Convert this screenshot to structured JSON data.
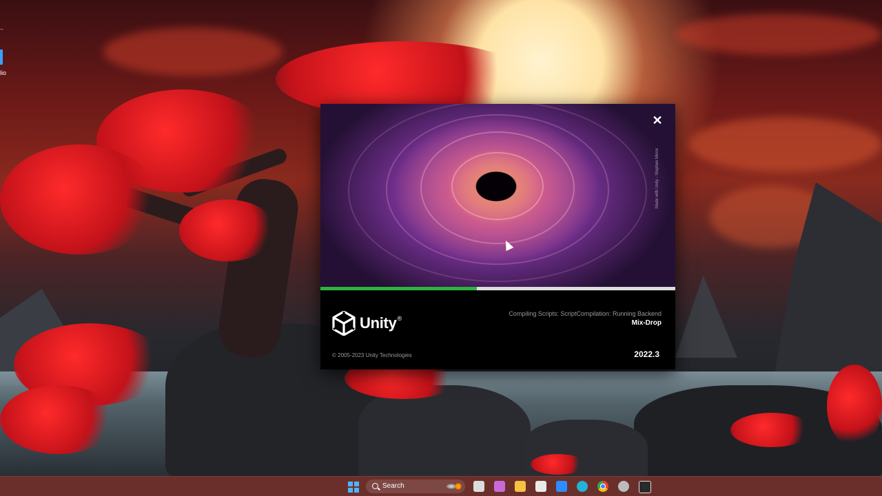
{
  "desktop": {
    "icon_labels": [
      "..",
      "lio"
    ]
  },
  "splash": {
    "watermark": "Made with Unity - Stephen Mirror",
    "progress_percent": 44,
    "logo_text": "Unity",
    "logo_reg": "®",
    "status_text": "Compiling Scripts: ScriptCompilation: Running Backend",
    "project_name": "Mix-Drop",
    "copyright": "© 2005-2023 Unity Technologies",
    "version": "2022.3",
    "close_symbol": "✕"
  },
  "taskbar": {
    "search_label": "Search",
    "apps": [
      {
        "name": "task-view-icon",
        "color": "#dcdcdc"
      },
      {
        "name": "copilot-icon",
        "color": "#c86ad8"
      },
      {
        "name": "file-explorer-icon",
        "color": "#f5c242"
      },
      {
        "name": "microsoft-store-icon",
        "color": "#eaeaea"
      },
      {
        "name": "mail-icon",
        "color": "#2d8cff"
      },
      {
        "name": "edge-icon",
        "color": "#23b2d8"
      },
      {
        "name": "chrome-icon",
        "color": "#ffffff"
      },
      {
        "name": "unity-hub-icon",
        "color": "#bcbcbc"
      },
      {
        "name": "unity-editor-icon",
        "color": "#e0e0e0"
      }
    ]
  }
}
